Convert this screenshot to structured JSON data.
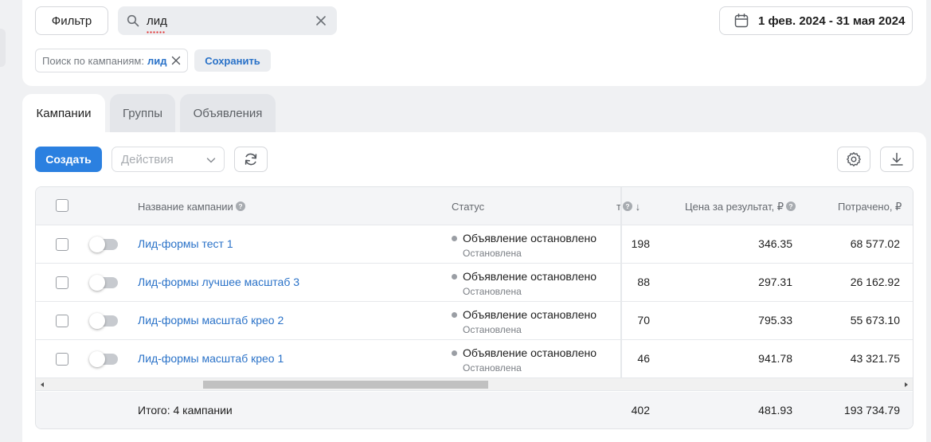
{
  "filters": {
    "filter_button": "Фильтр",
    "search_value": "лид",
    "date_range": "1 фев. 2024 - 31 мая 2024",
    "chip_label": "Поиск по кампаниям:",
    "chip_value": "лид",
    "save_button": "Сохранить"
  },
  "tabs": [
    {
      "label": "Кампании",
      "active": true
    },
    {
      "label": "Группы",
      "active": false
    },
    {
      "label": "Объявления",
      "active": false
    }
  ],
  "toolbar": {
    "create_button": "Создать",
    "actions_placeholder": "Действия"
  },
  "table": {
    "headers": {
      "name": "Название кампании",
      "status": "Статус",
      "results_partial": "т",
      "sort_arrow": "↓",
      "cost_per_result": "Цена за результат, ₽",
      "spent": "Потрачено, ₽"
    },
    "rows": [
      {
        "name": "Лид-формы тест 1",
        "status": "Объявление остановлено",
        "sub_status": "Остановлена",
        "results": "198",
        "cpr": "346.35",
        "spent": "68 577.02"
      },
      {
        "name": "Лид-формы лучшее масштаб 3",
        "status": "Объявление остановлено",
        "sub_status": "Остановлена",
        "results": "88",
        "cpr": "297.31",
        "spent": "26 162.92"
      },
      {
        "name": "Лид-формы масштаб крео 2",
        "status": "Объявление остановлено",
        "sub_status": "Остановлена",
        "results": "70",
        "cpr": "795.33",
        "spent": "55 673.10"
      },
      {
        "name": "Лид-формы масштаб крео 1",
        "status": "Объявление остановлено",
        "sub_status": "Остановлена",
        "results": "46",
        "cpr": "941.78",
        "spent": "43 321.75"
      }
    ],
    "footer": {
      "label": "Итого: 4 кампании",
      "results": "402",
      "cpr": "481.93",
      "spent": "193 734.79"
    }
  },
  "colors": {
    "accent": "#2b80e0",
    "link": "#2a72c8",
    "background": "#f0f1f3"
  },
  "icons": [
    "search-icon",
    "close-icon",
    "calendar-icon",
    "chevron-down-icon",
    "refresh-icon",
    "gear-icon",
    "download-icon",
    "help-icon",
    "sort-arrow-icon"
  ]
}
